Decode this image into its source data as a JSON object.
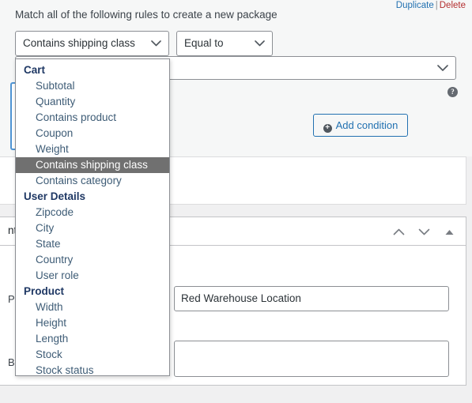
{
  "rule_panel": {
    "duplicate_label": "Duplicate",
    "separator": "|",
    "delete_label": "Delete",
    "heading": "Match all of the following rules to create a new package",
    "field_select_value": "Contains shipping class",
    "operator_select_value": "Equal to",
    "value_select_value": "",
    "chevron_glyph": "⌄",
    "help_glyph": "?",
    "add_condition_label": "Add condition",
    "add_condition_plus": "+"
  },
  "dropdown": {
    "groups": [
      {
        "label": "Cart",
        "items": [
          {
            "label": "Subtotal",
            "selected": false
          },
          {
            "label": "Quantity",
            "selected": false
          },
          {
            "label": "Contains product",
            "selected": false
          },
          {
            "label": "Coupon",
            "selected": false
          },
          {
            "label": "Weight",
            "selected": false
          },
          {
            "label": "Contains shipping class",
            "selected": true
          },
          {
            "label": "Contains category",
            "selected": false
          }
        ]
      },
      {
        "label": "User Details",
        "items": [
          {
            "label": "Zipcode",
            "selected": false
          },
          {
            "label": "City",
            "selected": false
          },
          {
            "label": "State",
            "selected": false
          },
          {
            "label": "Country",
            "selected": false
          },
          {
            "label": "User role",
            "selected": false
          }
        ]
      },
      {
        "label": "Product",
        "items": [
          {
            "label": "Width",
            "selected": false
          },
          {
            "label": "Height",
            "selected": false
          },
          {
            "label": "Length",
            "selected": false
          },
          {
            "label": "Stock",
            "selected": false
          },
          {
            "label": "Stock status",
            "selected": false
          }
        ]
      }
    ]
  },
  "metabox": {
    "title": "ntent",
    "move_up_glyph": "⌃",
    "move_down_glyph": "⌄",
    "toggle_glyph": "▲",
    "rows": [
      {
        "label": "P",
        "value": "Red Warehouse Location"
      },
      {
        "label": "B",
        "value": ""
      }
    ]
  },
  "colors": {
    "page_background": "#f0f0f1",
    "panel_background": "#f6f7f7",
    "link_blue": "#2271b1",
    "link_red": "#b32d2e",
    "dropdown_group": "#1f3864",
    "dropdown_item": "#3e5c76",
    "dropdown_highlight": "#707070",
    "focus_blue": "#4f94d4"
  }
}
